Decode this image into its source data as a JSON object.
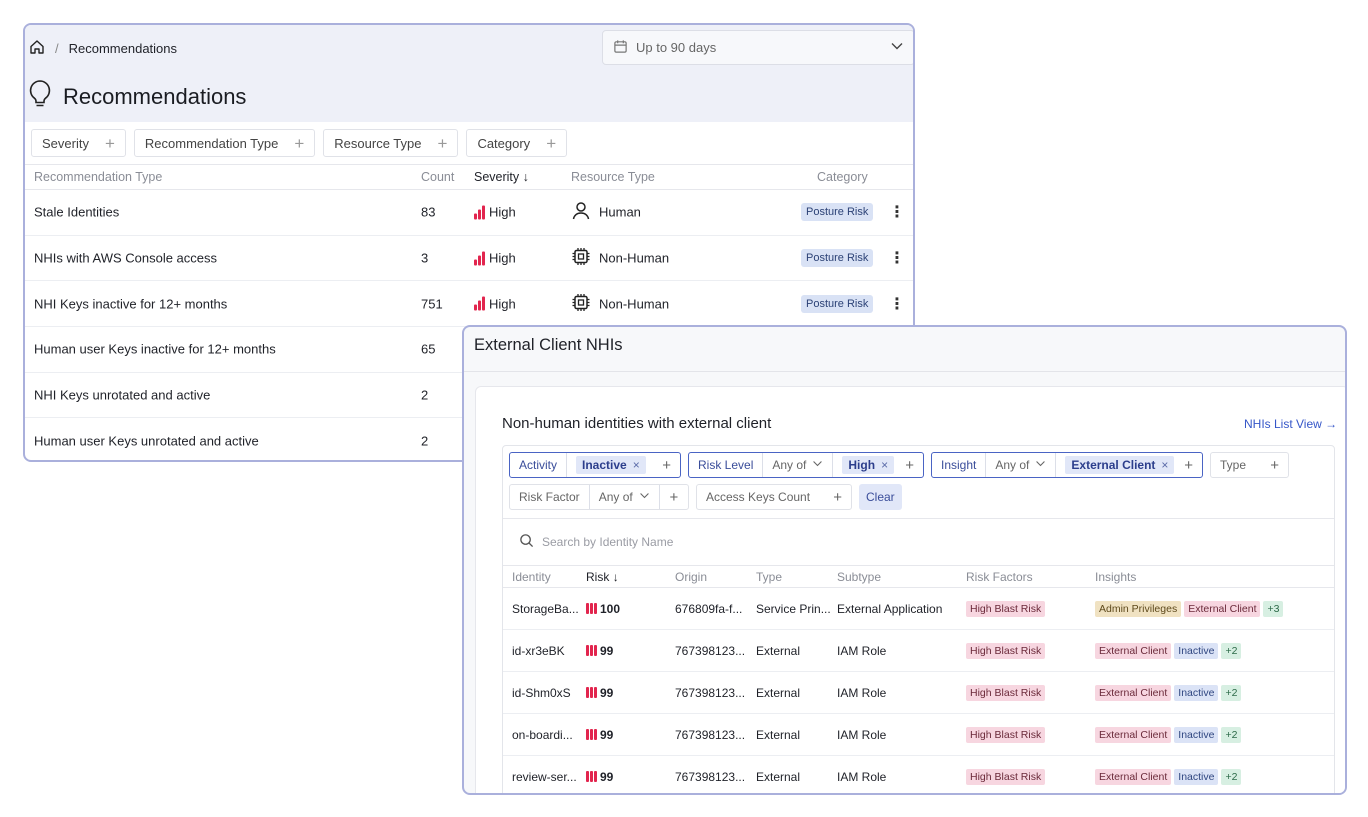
{
  "breadcrumb": {
    "current": "Recommendations"
  },
  "date_filter": {
    "label": "Up to 90 days"
  },
  "page": {
    "title": "Recommendations"
  },
  "rec_filters": [
    {
      "label": "Severity"
    },
    {
      "label": "Recommendation Type"
    },
    {
      "label": "Resource Type"
    },
    {
      "label": "Category"
    }
  ],
  "rec_table": {
    "headers": {
      "type": "Recommendation Type",
      "count": "Count",
      "severity": "Severity",
      "resource": "Resource Type",
      "category": "Category"
    },
    "rows": [
      {
        "type": "Stale Identities",
        "count": "83",
        "severity": "High",
        "resource": "Human",
        "resource_icon": "person-icon",
        "category": "Posture Risk"
      },
      {
        "type": "NHIs with AWS Console access",
        "count": "3",
        "severity": "High",
        "resource": "Non-Human",
        "resource_icon": "chip-icon",
        "category": "Posture Risk"
      },
      {
        "type": "NHI Keys inactive for 12+ months",
        "count": "751",
        "severity": "High",
        "resource": "Non-Human",
        "resource_icon": "chip-icon",
        "category": "Posture Risk"
      },
      {
        "type": "Human user Keys inactive for 12+ months",
        "count": "65"
      },
      {
        "type": "NHI Keys unrotated and active",
        "count": "2"
      },
      {
        "type": "Human user Keys unrotated and active",
        "count": "2"
      }
    ]
  },
  "nhi_panel": {
    "title": "External Client NHIs",
    "subtitle": "Non-human identities with external client",
    "list_link": "NHIs List View →",
    "filters": {
      "activity": {
        "label": "Activity",
        "value": "Inactive"
      },
      "risk_level": {
        "label": "Risk Level",
        "op": "Any of",
        "value": "High"
      },
      "insight": {
        "label": "Insight",
        "op": "Any of",
        "value": "External Client"
      },
      "type": {
        "label": "Type"
      },
      "risk_factor": {
        "label": "Risk Factor",
        "op": "Any of"
      },
      "access_keys": {
        "label": "Access Keys Count"
      },
      "clear": "Clear"
    },
    "search_placeholder": "Search by Identity Name",
    "headers": {
      "identity": "Identity",
      "risk": "Risk",
      "origin": "Origin",
      "type": "Type",
      "subtype": "Subtype",
      "risk_factors": "Risk Factors",
      "insights": "Insights"
    },
    "rows": [
      {
        "identity": "StorageBa...",
        "risk": "100",
        "origin": "676809fa-f...",
        "type": "Service Prin...",
        "subtype": "External Application",
        "risk_factor": "High Blast Risk",
        "insights": [
          "Admin Privileges",
          "External Client",
          "+3"
        ]
      },
      {
        "identity": "id-xr3eBK",
        "risk": "99",
        "origin": "767398123...",
        "type": "External",
        "subtype": "IAM Role",
        "risk_factor": "High Blast Risk",
        "insights": [
          "External Client",
          "Inactive",
          "+2"
        ]
      },
      {
        "identity": "id-Shm0xS",
        "risk": "99",
        "origin": "767398123...",
        "type": "External",
        "subtype": "IAM Role",
        "risk_factor": "High Blast Risk",
        "insights": [
          "External Client",
          "Inactive",
          "+2"
        ]
      },
      {
        "identity": "on-boardi...",
        "risk": "99",
        "origin": "767398123...",
        "type": "External",
        "subtype": "IAM Role",
        "risk_factor": "High Blast Risk",
        "insights": [
          "External Client",
          "Inactive",
          "+2"
        ]
      },
      {
        "identity": "review-ser...",
        "risk": "99",
        "origin": "767398123...",
        "type": "External",
        "subtype": "IAM Role",
        "risk_factor": "High Blast Risk",
        "insights": [
          "External Client",
          "Inactive",
          "+2"
        ]
      }
    ]
  },
  "colors": {
    "accent": "#3556c8",
    "severity_high": "#e2254e",
    "frame": "#aab0dc"
  }
}
